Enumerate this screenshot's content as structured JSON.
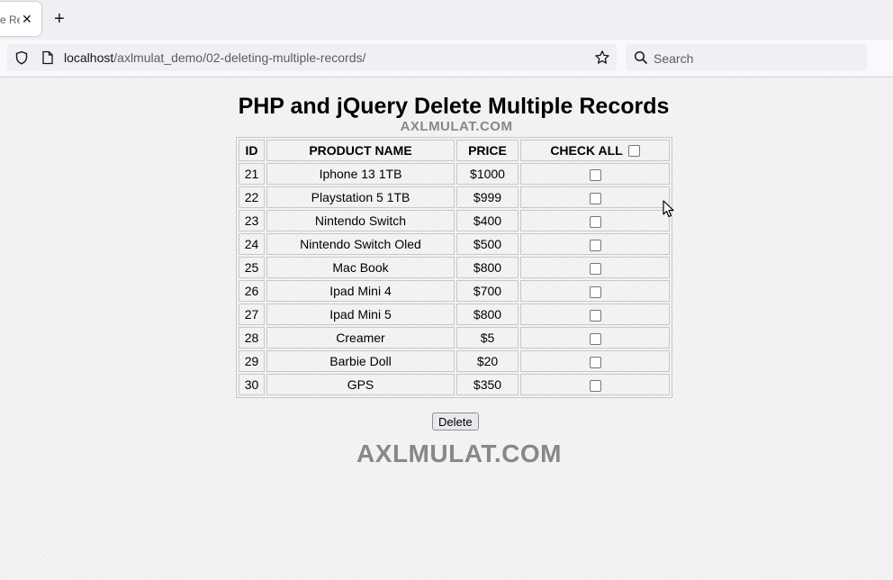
{
  "browser": {
    "tab_title": "e Rec",
    "url_host": "localhost",
    "url_path": "/axlmulat_demo/02-deleting-multiple-records/",
    "search_placeholder": "Search"
  },
  "page": {
    "title": "PHP and jQuery Delete Multiple Records",
    "watermark_small": "AXLMULAT.COM",
    "watermark_big": "AXLMULAT.COM",
    "delete_label": "Delete"
  },
  "table": {
    "headers": {
      "id": "ID",
      "name": "PRODUCT NAME",
      "price": "PRICE",
      "check_all": "CHECK ALL"
    },
    "rows": [
      {
        "id": "21",
        "name": "Iphone 13 1TB",
        "price": "$1000"
      },
      {
        "id": "22",
        "name": "Playstation 5 1TB",
        "price": "$999"
      },
      {
        "id": "23",
        "name": "Nintendo Switch",
        "price": "$400"
      },
      {
        "id": "24",
        "name": "Nintendo Switch Oled",
        "price": "$500"
      },
      {
        "id": "25",
        "name": "Mac Book",
        "price": "$800"
      },
      {
        "id": "26",
        "name": "Ipad Mini 4",
        "price": "$700"
      },
      {
        "id": "27",
        "name": "Ipad Mini 5",
        "price": "$800"
      },
      {
        "id": "28",
        "name": "Creamer",
        "price": "$5"
      },
      {
        "id": "29",
        "name": "Barbie Doll",
        "price": "$20"
      },
      {
        "id": "30",
        "name": "GPS",
        "price": "$350"
      }
    ]
  }
}
